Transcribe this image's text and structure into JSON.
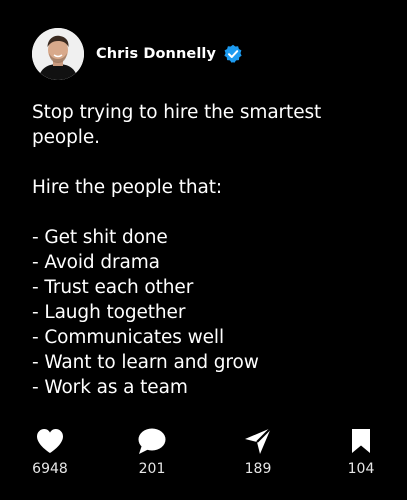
{
  "author": {
    "name": "Chris Donnelly",
    "verified_icon": "verified-badge-icon",
    "verified_color": "#1d9bf0"
  },
  "post": {
    "lines": [
      "Stop trying to hire the smartest",
      "people.",
      "",
      "Hire the people that:",
      "",
      "- Get shit done",
      "- Avoid drama",
      "- Trust each other",
      "- Laugh together",
      "- Communicates well",
      "- Want to learn and grow",
      "- Work as a team"
    ]
  },
  "actions": {
    "likes": {
      "icon": "heart-icon",
      "count": "6948"
    },
    "comments": {
      "icon": "comment-bubble-icon",
      "count": "201"
    },
    "shares": {
      "icon": "send-arrow-icon",
      "count": "189"
    },
    "bookmarks": {
      "icon": "bookmark-icon",
      "count": "104"
    }
  },
  "colors": {
    "background": "#000000",
    "text": "#ffffff"
  }
}
